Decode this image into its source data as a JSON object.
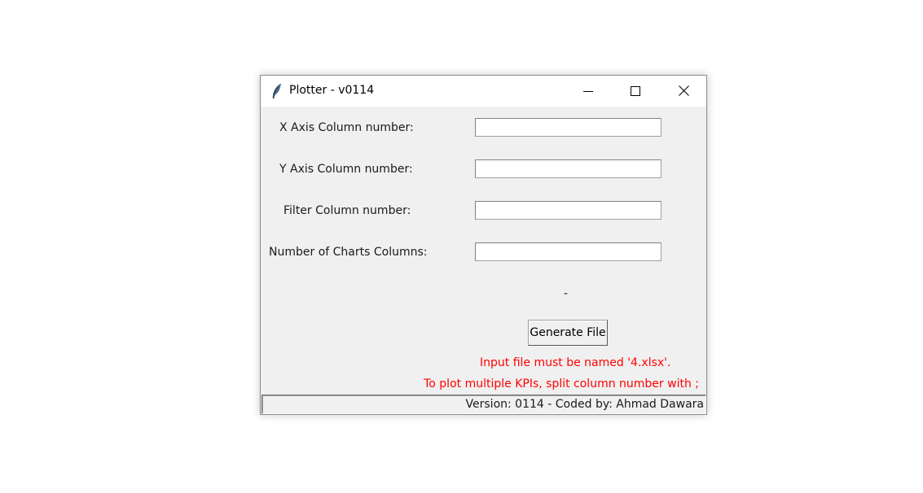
{
  "window": {
    "title": "Plotter - v0114"
  },
  "titlebar_buttons": {
    "minimize": "minimize-icon",
    "maximize": "maximize-icon",
    "close": "close-icon"
  },
  "form": {
    "x_axis_label": "X Axis Column number:",
    "x_axis_value": "",
    "y_axis_label": "Y Axis Column number:",
    "y_axis_value": "",
    "filter_label": "Filter Column number:",
    "filter_value": "",
    "charts_columns_label": "Number of Charts Columns:",
    "charts_columns_value": "",
    "status_dash": "-",
    "generate_label": "Generate File"
  },
  "notes": {
    "file_name": "Input file must be named '4.xlsx'.",
    "multiple_kpis": "To plot multiple KPIs, split column number with ;"
  },
  "statusbar": {
    "text": "Version: 0114 - Coded by: Ahmad Dawara"
  },
  "colors": {
    "warning": "#ff0000",
    "window_bg": "#f0f0f0",
    "titlebar_bg": "#ffffff"
  }
}
